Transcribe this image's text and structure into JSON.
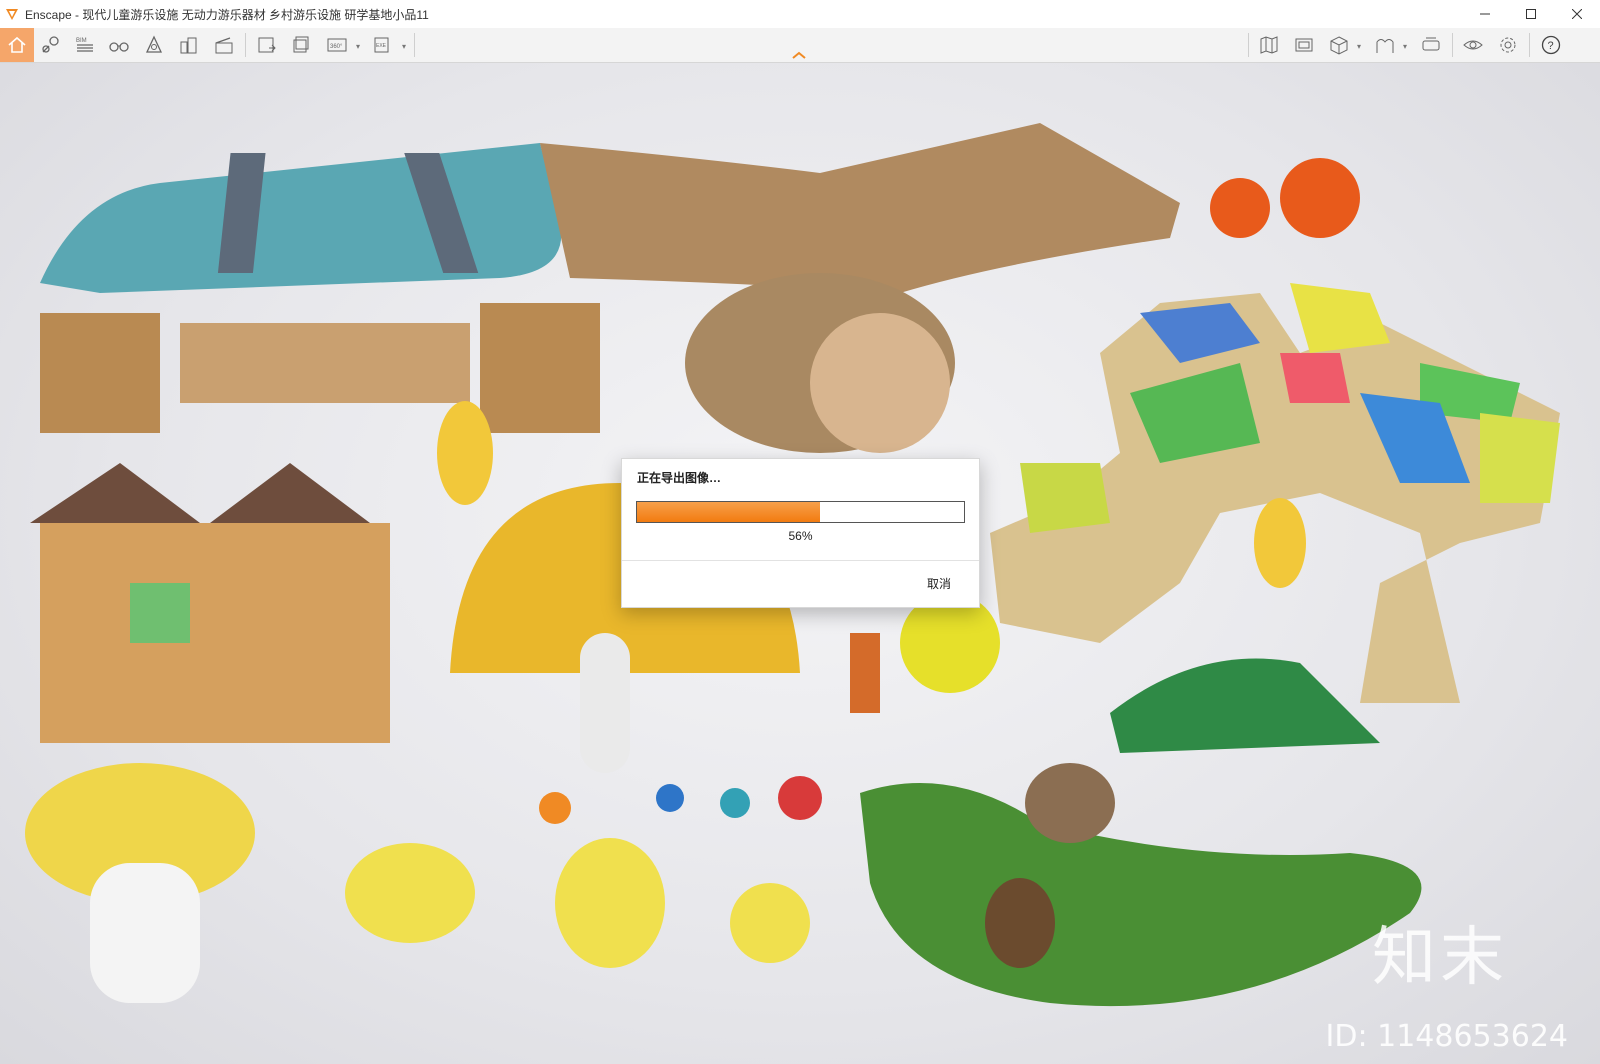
{
  "window": {
    "title": "Enscape - 现代儿童游乐设施 无动力游乐器材 乡村游乐设施 研学基地小品11",
    "accent_color": "#f08a24"
  },
  "toolbar": {
    "left_tools": [
      "home-icon",
      "visual-settings-icon",
      "bim-icon",
      "binoculars-icon",
      "views-icon",
      "assets-icon",
      "clapper-icon",
      "render-image-icon",
      "batch-render-icon",
      "panorama-360-icon",
      "export-exe-icon"
    ],
    "right_tools": [
      "map-icon",
      "screenshot-icon",
      "cube-icon",
      "material-icon",
      "vr-headset-icon",
      "eye-icon",
      "gear-icon",
      "help-icon"
    ],
    "bim_label": "BIM",
    "pano_label": "360°",
    "exe_label": "EXE"
  },
  "dialog": {
    "title": "正在导出图像…",
    "progress": 0.56,
    "percent_text": "56%",
    "cancel_label": "取消"
  },
  "watermark": {
    "brand": "知末",
    "id_text": "ID: 1148653624"
  }
}
